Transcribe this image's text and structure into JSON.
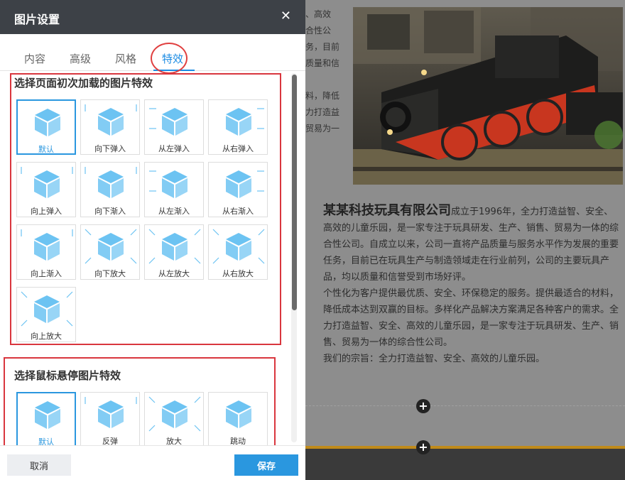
{
  "background": {
    "left_text": [
      "、高效",
      "合性公",
      "务，目前",
      "质量和信",
      "",
      "料，降低",
      "力打造益",
      "贸易为一"
    ],
    "company_name": "某某科技玩具有限公司",
    "paragraph1": "成立于1996年，全力打造益智、安全、高效的儿童乐园，是一家专注于玩具研发、生产、销售、贸易为一体的综合性公司。自成立以来，公司一直将产品质量与服务水平作为发展的重要任务，目前已在玩具生产与制造领域走在行业前列，公司的主要玩具产品，均以质量和信誉受到市场好评。",
    "paragraph2": "个性化为客户提供最优质、安全、环保稳定的服务。提供最适合的材料，降低成本达到双赢的目标。多样化产品解决方案满足各种客户的需求。全力打造益智、安全、高效的儿童乐园，是一家专注于玩具研发、生产、销售、贸易为一体的综合性公司。",
    "paragraph3": "我们的宗旨：全力打造益智、安全、高效的儿童乐园。",
    "plus_icon": "+"
  },
  "dialog": {
    "title": "图片设置",
    "close_icon": "✕",
    "tabs": [
      "内容",
      "高级",
      "风格",
      "特效"
    ],
    "active_tab": "特效",
    "load_section_title": "选择页面初次加载的图片特效",
    "load_effects": [
      "默认",
      "向下弹入",
      "从左弹入",
      "从右弹入",
      "向上弹入",
      "向下渐入",
      "从左渐入",
      "从右渐入",
      "向上渐入",
      "向下放大",
      "从左放大",
      "从右放大",
      "向上放大"
    ],
    "hover_section_title": "选择鼠标悬停图片特效",
    "hover_effects": [
      "默认",
      "反弹",
      "放大",
      "跳动"
    ],
    "cancel_label": "取消",
    "save_label": "保存"
  },
  "colors": {
    "accent": "#2a97df",
    "highlight_border": "#d9363e",
    "header_bg": "#3d4147",
    "cube": "#6cc3f2"
  }
}
